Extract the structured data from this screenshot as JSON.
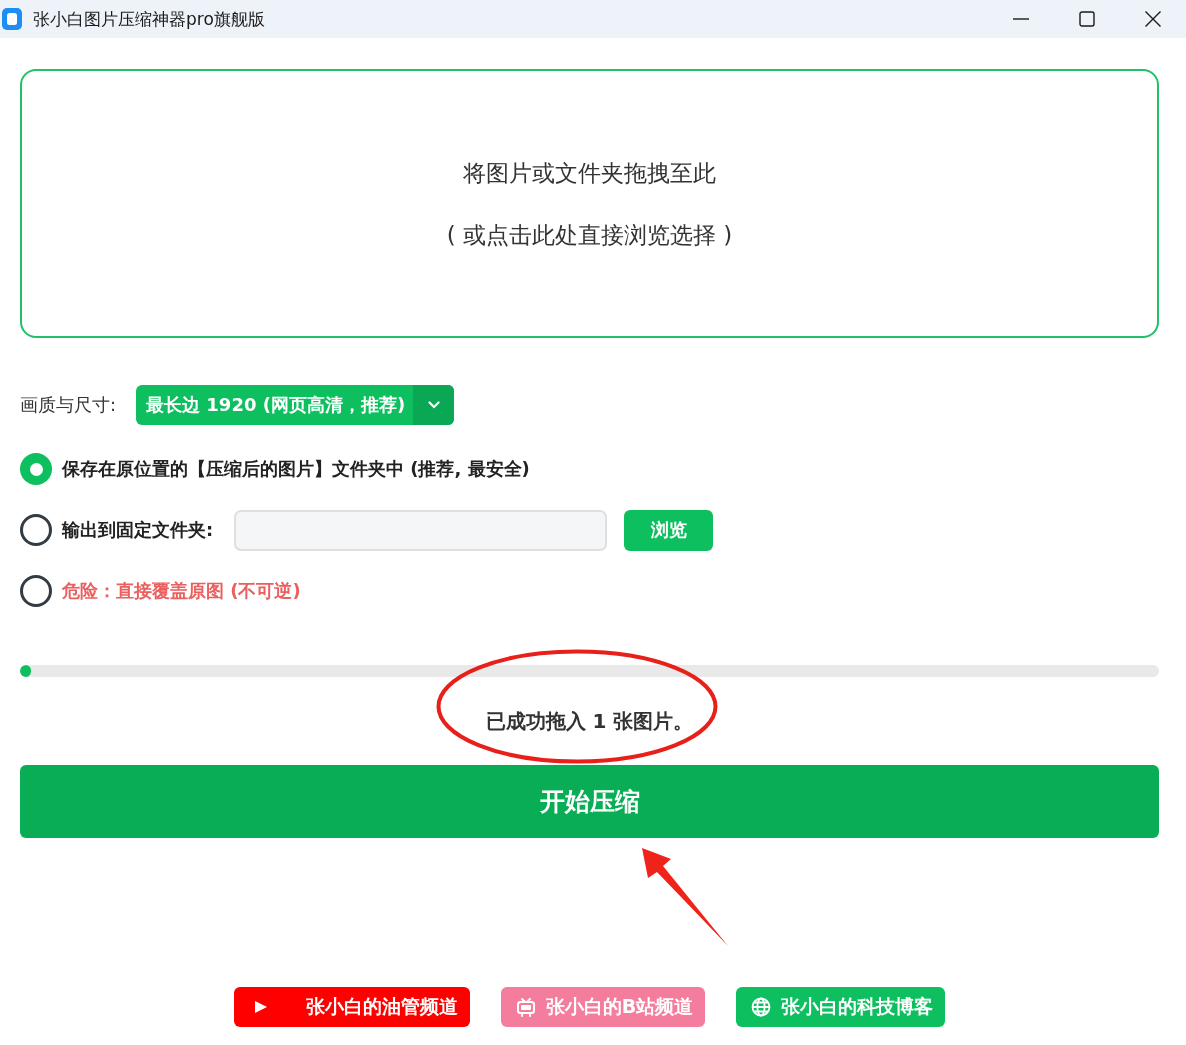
{
  "window": {
    "title": "张小白图片压缩神器pro旗舰版"
  },
  "drop_zone": {
    "lines": [
      "将图片或文件夹拖拽至此",
      "( 或点击此处直接浏览选择 )"
    ]
  },
  "quality": {
    "label": "画质与尺寸:",
    "value": "最长边 1920 (网页高清，推荐)"
  },
  "save_options": [
    {
      "kind": "plain",
      "label": "保存在原位置的【压缩后的图片】文件夹中 (推荐, 最安全)",
      "selected": true
    },
    {
      "kind": "folder",
      "label": "输出到固定文件夹:",
      "selected": false,
      "button": "浏览"
    },
    {
      "kind": "danger",
      "label": "危险：直接覆盖原图 (不可逆)",
      "selected": false
    }
  ],
  "progress": {
    "level": 0.01
  },
  "status": {
    "text": "已成功拖入 1 张图片。",
    "circled": true
  },
  "start_button": {
    "label": "开始压缩",
    "arrow_pointing": true
  },
  "links": [
    {
      "kind": "play",
      "label": "张小白的油管频道",
      "color": "#ff0000"
    },
    {
      "kind": "tv",
      "label": "张小白的B站频道",
      "color": "#f47c9c"
    },
    {
      "kind": "globe",
      "label": "张小白的科技博客",
      "color": "#0dbf5f"
    }
  ]
}
